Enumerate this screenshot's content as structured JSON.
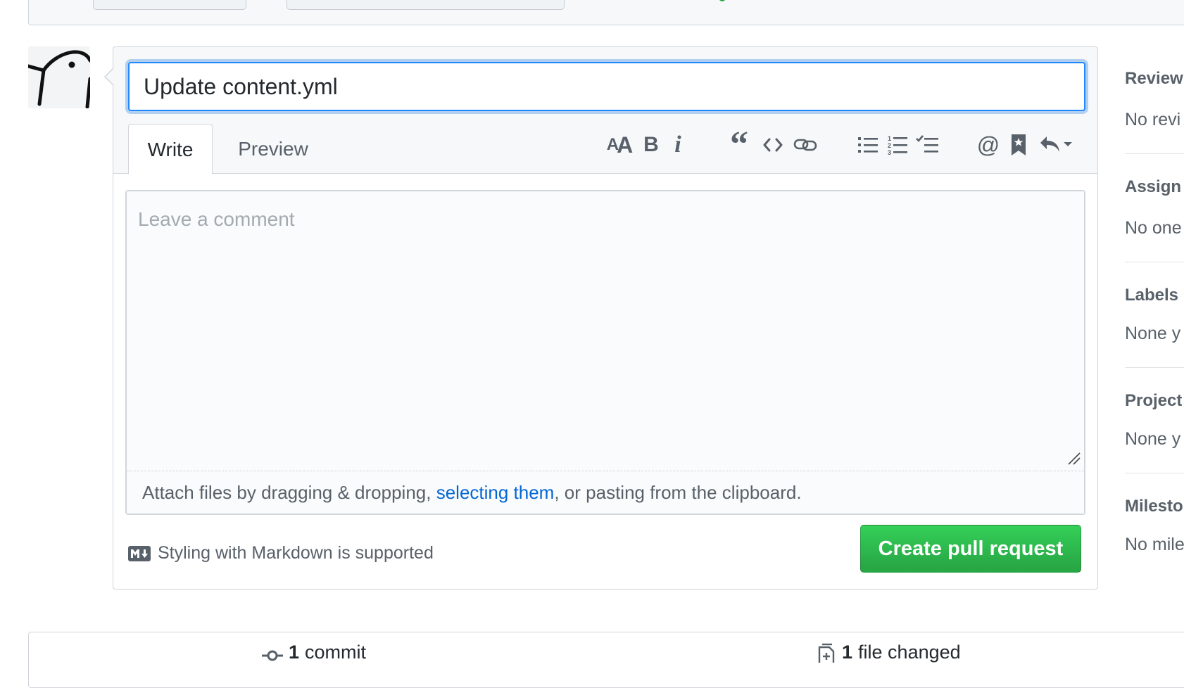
{
  "form": {
    "title_value": "Update content.yml",
    "tabs": [
      {
        "label": "Write",
        "active": true
      },
      {
        "label": "Preview",
        "active": false
      }
    ],
    "toolbar": [
      {
        "icon": "text-size-icon",
        "glyph": "AA"
      },
      {
        "icon": "bold-icon",
        "glyph": "B"
      },
      {
        "icon": "italic-icon",
        "glyph": "i"
      },
      {
        "icon": "quote-icon",
        "glyph": "“"
      },
      {
        "icon": "code-icon",
        "glyph": "<>"
      },
      {
        "icon": "link-icon",
        "glyph": ""
      },
      {
        "icon": "unordered-list-icon",
        "glyph": ""
      },
      {
        "icon": "ordered-list-icon",
        "glyph": ""
      },
      {
        "icon": "task-list-icon",
        "glyph": ""
      },
      {
        "icon": "mention-icon",
        "glyph": "@"
      },
      {
        "icon": "bookmark-icon",
        "glyph": ""
      },
      {
        "icon": "reply-icon",
        "glyph": ""
      }
    ],
    "comment_placeholder": "Leave a comment",
    "attach": {
      "prefix": "Attach files by dragging & dropping, ",
      "link": "selecting them",
      "suffix": ", or pasting from the clipboard."
    },
    "markdown_note": "Styling with Markdown is supported",
    "submit_label": "Create pull request"
  },
  "sidebar": [
    {
      "title": "Review",
      "value": "No revi"
    },
    {
      "title": "Assign",
      "value": "No one"
    },
    {
      "title": "Labels",
      "value": "None y"
    },
    {
      "title": "Project",
      "value": "None y"
    },
    {
      "title": "Milesto",
      "value": "No mile"
    }
  ],
  "stats": {
    "commits": {
      "count": "1",
      "label": "commit"
    },
    "files": {
      "count": "1",
      "label": "file changed"
    }
  },
  "colors": {
    "accent": "#0366d6",
    "success": "#28a745",
    "border": "#d1d5da"
  }
}
